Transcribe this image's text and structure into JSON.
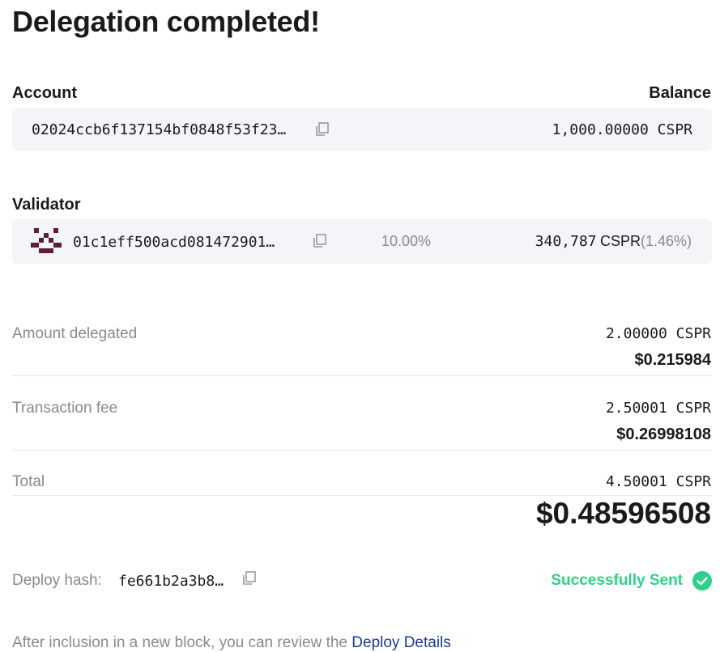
{
  "page": {
    "title": "Delegation completed!"
  },
  "account": {
    "label": "Account",
    "balance_label": "Balance",
    "address": "02024ccb6f137154bf0848f53f23…",
    "balance": "1,000.00000 CSPR"
  },
  "validator": {
    "label": "Validator",
    "address": "01c1eff500acd081472901…",
    "commission": "10.00%",
    "stake_amount": "340,787",
    "stake_unit": "CSPR",
    "stake_share": "(1.46%)"
  },
  "summary": {
    "amount_label": "Amount delegated",
    "amount_cspr": "2.00000 CSPR",
    "amount_usd": "$0.215984",
    "fee_label": "Transaction fee",
    "fee_cspr": "2.50001 CSPR",
    "fee_usd": "$0.26998108",
    "total_label": "Total",
    "total_cspr": "4.50001 CSPR",
    "total_usd": "$0.48596508"
  },
  "deploy": {
    "hash_label": "Deploy hash:",
    "hash_value": "fe661b2a3b8…",
    "status": "Successfully Sent",
    "status_color": "#2fd18a"
  },
  "footer": {
    "text": "After inclusion in a new block, you can review the",
    "link": "Deploy Details",
    "link_color": "#1b3a8f"
  },
  "icons": {
    "copy": "copy-icon",
    "check": "check-circle-icon",
    "identicon": "validator-identicon"
  }
}
